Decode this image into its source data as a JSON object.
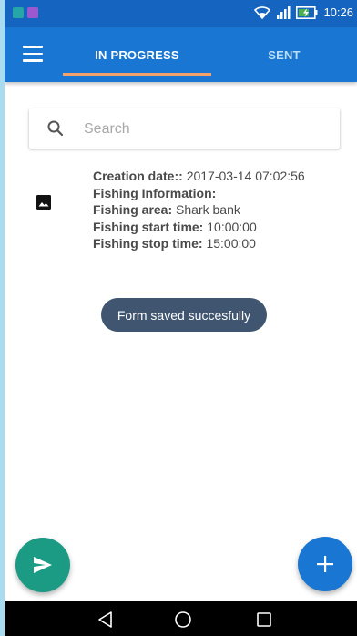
{
  "status_bar": {
    "time": "10:26",
    "notification_colors": [
      "#26a6a6",
      "#9b59d0"
    ],
    "icons": [
      "wifi-icon",
      "signal-icon",
      "battery-icon"
    ]
  },
  "app_bar": {
    "color": "#1976d2",
    "tabs": [
      {
        "label": "IN PROGRESS",
        "active": true
      },
      {
        "label": "SENT",
        "active": false
      }
    ],
    "indicator_color": "#f4a26a"
  },
  "search": {
    "placeholder": "Search",
    "value": ""
  },
  "forms": [
    {
      "icon": "image-icon",
      "lines": [
        {
          "label": "Creation date::",
          "value": "2017-03-14 07:02:56"
        },
        {
          "label": "Fishing Information:",
          "value": ""
        },
        {
          "label": "Fishing area:",
          "value": "Shark bank"
        },
        {
          "label": "Fishing start time:",
          "value": "10:00:00"
        },
        {
          "label": "Fishing stop time:",
          "value": "15:00:00"
        }
      ]
    }
  ],
  "toast": {
    "message": "Form saved succesfully"
  },
  "fabs": {
    "send_color": "#1b9a84",
    "add_color": "#1976d2"
  },
  "nav_bar": {
    "buttons": [
      "back-icon",
      "home-icon",
      "recents-icon"
    ]
  }
}
